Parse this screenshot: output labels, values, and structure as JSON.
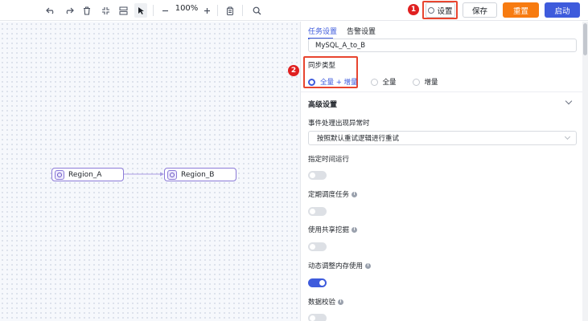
{
  "toolbar": {
    "zoom_value": "100%",
    "settings_label": "设置",
    "save_label": "保存",
    "reset_label": "重置",
    "start_label": "启动",
    "icons": [
      "undo-icon",
      "redo-icon",
      "delete-icon",
      "fit-view-icon",
      "auto-layout-icon",
      "select-icon",
      "zoom-out-icon",
      "zoom-in-icon",
      "clipboard-icon",
      "search-icon"
    ]
  },
  "annotations": {
    "badge_1": "1",
    "badge_2": "2"
  },
  "canvas": {
    "nodes": [
      {
        "label": "Region_A"
      },
      {
        "label": "Region_B"
      }
    ]
  },
  "panel": {
    "tabs": [
      {
        "label": "任务设置",
        "active": true
      },
      {
        "label": "告警设置",
        "active": false
      }
    ],
    "task_name_value": "MySQL_A_to_B",
    "sync_type_label": "同步类型",
    "sync_options": [
      {
        "label": "全量 + 增量",
        "selected": true
      },
      {
        "label": "全量",
        "selected": false
      },
      {
        "label": "增量",
        "selected": false
      }
    ],
    "advanced_title": "高级设置",
    "event_error_label": "事件处理出现异常时",
    "event_error_value": "按照默认重试逻辑进行重试",
    "scheduled_run_label": "指定时间运行",
    "scheduled_run_on": false,
    "periodic_task_label": "定期调度任务",
    "periodic_task_on": false,
    "shared_mining_label": "使用共享挖掘",
    "shared_mining_on": false,
    "dynamic_memory_label": "动态调整内存使用",
    "dynamic_memory_on": true,
    "data_validation_label": "数据校验",
    "data_validation_on": false
  },
  "colors": {
    "accent": "#3e5bdc",
    "reset_orange": "#f77b10",
    "annotation_red": "#e02020",
    "node_border": "#8b7ad8"
  }
}
